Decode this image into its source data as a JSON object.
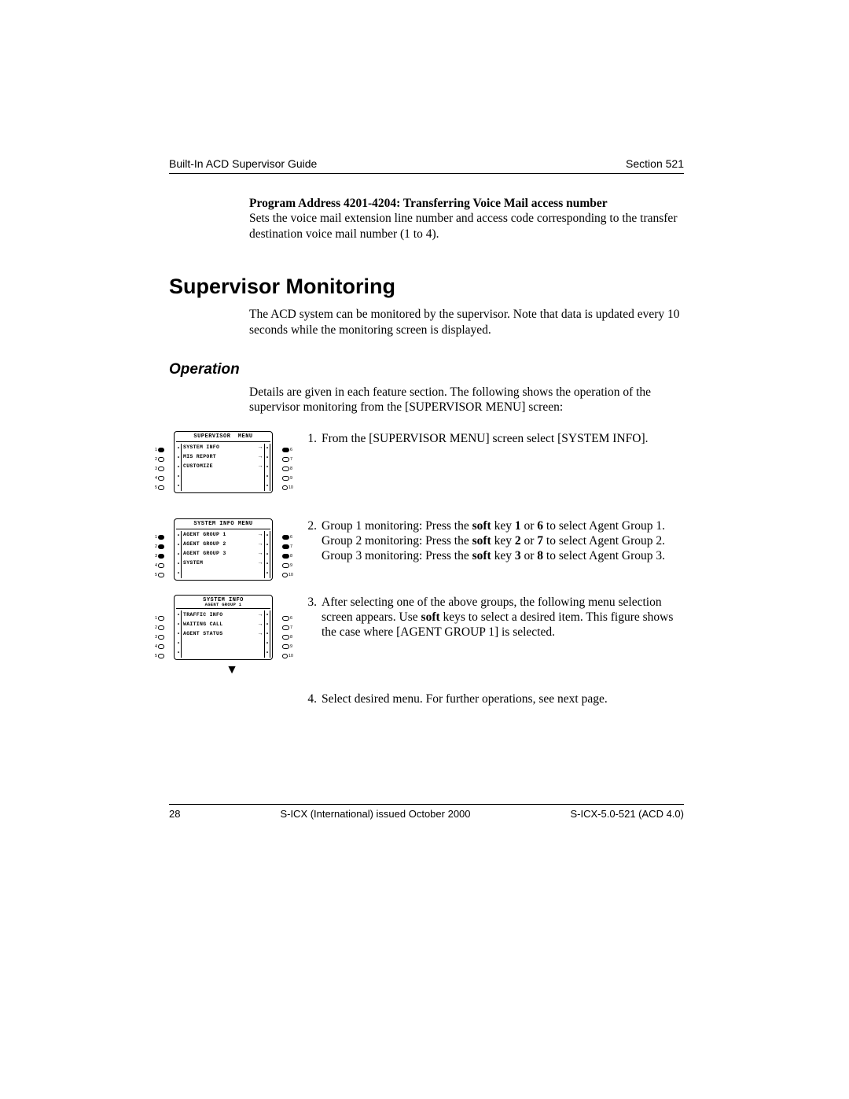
{
  "header": {
    "left": "Built-In ACD Supervisor Guide",
    "right": "Section 521"
  },
  "program": {
    "title": "Program Address 4201-4204: Transferring Voice Mail access number",
    "body": "Sets the voice mail extension line number and access code corresponding to the transfer destination voice mail number (1 to 4)."
  },
  "heading": "Supervisor Monitoring",
  "intro": "The ACD system can be monitored by the supervisor. Note that data is updated every 10 seconds while the monitoring screen is displayed.",
  "operation_heading": "Operation",
  "operation_intro": "Details are given in each feature section. The following shows the operation of the supervisor monitoring from the [SUPERVISOR MENU] screen:",
  "steps": {
    "s1": {
      "num": "1.",
      "text": "From the [SUPERVISOR MENU] screen select [SYSTEM INFO].",
      "diagram_title": "SUPERVISOR  MENU",
      "items": [
        "SYSTEM INFO",
        "MIS REPORT",
        "CUSTOMIZE",
        "",
        ""
      ],
      "left_filled": [
        true,
        false,
        false,
        false,
        false
      ],
      "right_filled": [
        true,
        false,
        false,
        false,
        false
      ],
      "right_nums": [
        "6",
        "7",
        "8",
        "9",
        "10"
      ]
    },
    "s2": {
      "num": "2.",
      "text_a": "Group 1 monitoring: Press the ",
      "soft": "soft",
      "text_b1": " key ",
      "k1a": "1",
      "or": " or ",
      "k1b": "6",
      "tail1": " to select Agent Group 1.",
      "line2a": "Group 2 monitoring: Press the ",
      "k2a": "2",
      "k2b": "7",
      "tail2": " to select Agent Group 2.",
      "line3a": "Group 3 monitoring: Press the ",
      "k3a": "3",
      "k3b": "8",
      "tail3": " to select Agent Group 3.",
      "diagram_title": "SYSTEM INFO MENU",
      "items": [
        "AGENT GROUP 1",
        "AGENT GROUP 2",
        "AGENT GROUP 3",
        "SYSTEM",
        ""
      ],
      "left_filled": [
        true,
        true,
        true,
        false,
        false
      ],
      "right_filled": [
        true,
        true,
        true,
        false,
        false
      ],
      "right_nums": [
        "6",
        "7",
        "8",
        "9",
        "10"
      ]
    },
    "s3": {
      "num": "3.",
      "text_a": "After selecting one of the above groups, the following menu selection screen appears. Use ",
      "soft": "soft",
      "text_b": " keys to select a desired item. This figure shows the case where [AGENT GROUP 1] is selected.",
      "diagram_title": "SYSTEM INFO",
      "diagram_subtitle": "AGENT GROUP 1",
      "items": [
        "TRAFFIC INFO",
        "WAITING CALL",
        "AGENT STATUS",
        "",
        ""
      ],
      "left_filled": [
        false,
        false,
        false,
        false,
        false
      ],
      "right_filled": [
        false,
        false,
        false,
        false,
        false
      ],
      "right_nums": [
        "6",
        "7",
        "8",
        "9",
        "10"
      ]
    },
    "s4": {
      "num": "4.",
      "text": "Select desired menu. For further operations, see next page."
    }
  },
  "footer": {
    "page": "28",
    "center": "S-ICX (International) issued October 2000",
    "right": "S-ICX-5.0-521 (ACD 4.0)"
  }
}
